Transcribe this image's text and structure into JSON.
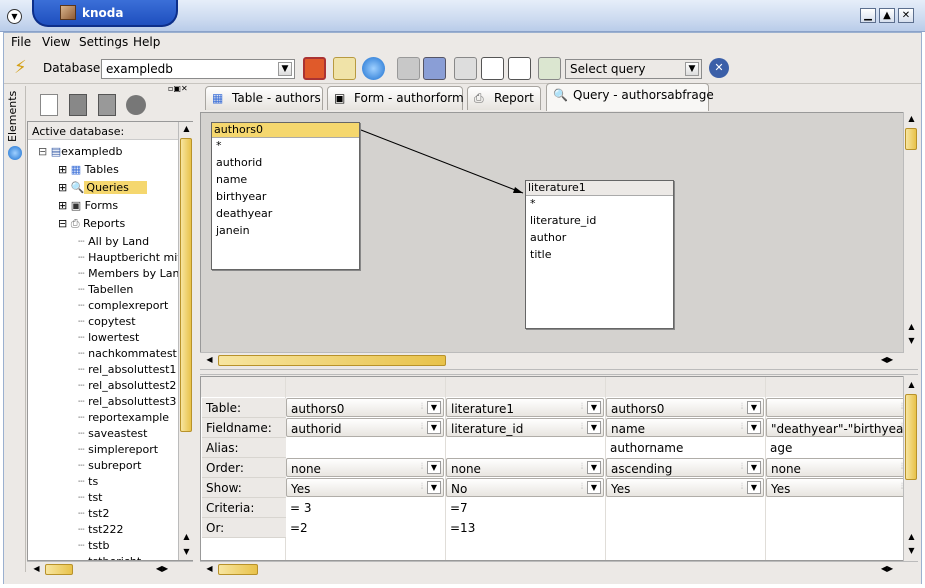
{
  "window": {
    "title": "knoda"
  },
  "menu": [
    "File",
    "View",
    "Settings",
    "Help"
  ],
  "toolbar": {
    "database_label": "Database:",
    "database_value": "exampledb",
    "query_mode": "Select query"
  },
  "left_panel": {
    "tab_label": "Elements",
    "header": "Active database:",
    "tree": {
      "root": "exampledb",
      "categories": [
        "Tables",
        "Queries",
        "Forms",
        "Reports"
      ],
      "reports": [
        "All by Land",
        "Hauptbericht mit",
        "Members by Lan",
        "Tabellen",
        "complexreport",
        "copytest",
        "lowertest",
        "nachkommatest",
        "rel_absoluttest1",
        "rel_absoluttest2",
        "rel_absoluttest3",
        "reportexample",
        "saveastest",
        "simplereport",
        "subreport",
        "ts",
        "tst",
        "tst2",
        "tst222",
        "tstb",
        "tstbericht"
      ]
    }
  },
  "tabs": [
    "Table - authors",
    "Form - authorform",
    "Report",
    "Query - authorsabfrage"
  ],
  "designer": {
    "tables": [
      {
        "name": "authors0",
        "fields": [
          "*",
          "authorid",
          "name",
          "birthyear",
          "deathyear",
          "janein"
        ]
      },
      {
        "name": "literature1",
        "fields": [
          "*",
          "literature_id",
          "author",
          "title"
        ]
      }
    ]
  },
  "grid": {
    "row_labels": [
      "Table:",
      "Fieldname:",
      "Alias:",
      "Order:",
      "Show:",
      "Criteria:",
      "Or:"
    ],
    "columns": [
      {
        "table": "authors0",
        "field": "authorid",
        "alias": "",
        "order": "none",
        "show": "Yes",
        "criteria": "= 3",
        "or": "=2"
      },
      {
        "table": "literature1",
        "field": "literature_id",
        "alias": "",
        "order": "none",
        "show": "No",
        "criteria": "=7",
        "or": "=13"
      },
      {
        "table": "authors0",
        "field": "name",
        "alias": "authorname",
        "order": "ascending",
        "show": "Yes",
        "criteria": "",
        "or": ""
      },
      {
        "table": "",
        "field": "\"deathyear\"-\"birthyear\"",
        "alias": "age",
        "order": "none",
        "show": "Yes",
        "criteria": "",
        "or": ""
      }
    ]
  },
  "colors": {
    "title_blue": "#1e4fbf",
    "selection_yellow": "#f5d76e",
    "scroll_thumb": "#e8c24a",
    "designer_bg": "#d4d2cf"
  }
}
